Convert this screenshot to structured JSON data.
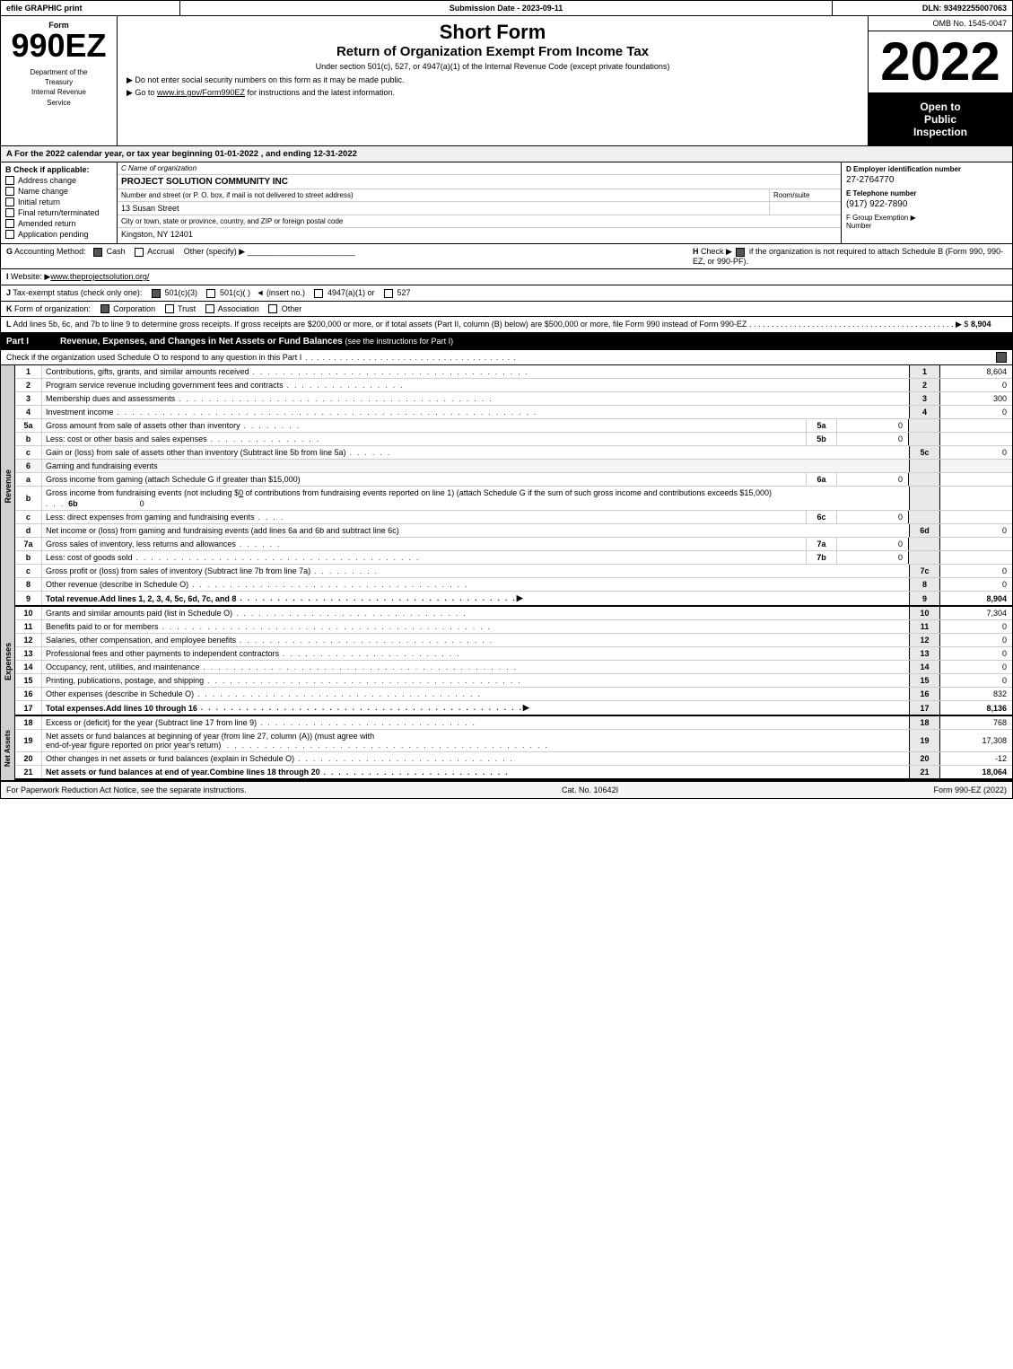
{
  "header": {
    "efile_label": "efile GRAPHIC print",
    "submission_label": "Submission Date - 2023-09-11",
    "dln_label": "DLN: 93492255007063"
  },
  "form_info": {
    "form_number": "990EZ",
    "dept_line1": "Department of the",
    "dept_line2": "Treasury",
    "dept_line3": "Internal Revenue",
    "dept_line4": "Service",
    "short_form": "Short Form",
    "return_title": "Return of Organization Exempt From Income Tax",
    "subtitle": "Under section 501(c), 527, or 4947(a)(1) of the Internal Revenue Code (except private foundations)",
    "bullet1": "▶ Do not enter social security numbers on this form as it may be made public.",
    "bullet2": "▶ Go to www.irs.gov/Form990EZ for instructions and the latest information.",
    "bullet2_link": "www.irs.gov/Form990EZ",
    "omb": "OMB No. 1545-0047",
    "year": "2022",
    "open_line1": "Open to",
    "open_line2": "Public",
    "open_line3": "Inspection"
  },
  "section_a": {
    "label": "A",
    "text": "For the 2022 calendar year, or tax year beginning 01-01-2022 , and ending 12-31-2022"
  },
  "section_b": {
    "label": "B",
    "check_label": "Check if applicable:",
    "options": [
      {
        "id": "address_change",
        "label": "Address change",
        "checked": false
      },
      {
        "id": "name_change",
        "label": "Name change",
        "checked": false
      },
      {
        "id": "initial_return",
        "label": "Initial return",
        "checked": false
      },
      {
        "id": "final_return",
        "label": "Final return/terminated",
        "checked": false
      },
      {
        "id": "amended_return",
        "label": "Amended return",
        "checked": false
      },
      {
        "id": "application_pending",
        "label": "Application pending",
        "checked": false
      }
    ]
  },
  "org": {
    "c_label": "C Name of organization",
    "name": "PROJECT SOLUTION COMMUNITY INC",
    "street_label": "Number and street (or P. O. box, if mail is not delivered to street address)",
    "street_value": "13 Susan Street",
    "room_label": "Room/suite",
    "room_value": "",
    "city_label": "City or town, state or province, country, and ZIP or foreign postal code",
    "city_value": "Kingston, NY 12401",
    "d_label": "D Employer identification number",
    "ein": "27-2764770",
    "e_label": "E Telephone number",
    "phone": "(917) 922-7890",
    "f_label": "F Group Exemption",
    "f_label2": "Number",
    "f_arrow": "▶"
  },
  "section_g": {
    "label": "G",
    "text": "Accounting Method:",
    "cash_label": "Cash",
    "cash_checked": true,
    "accrual_label": "Accrual",
    "accrual_checked": false,
    "other_label": "Other (specify) ▶",
    "other_line": "___________________________",
    "h_label": "H",
    "h_text": "Check ▶",
    "h_checked": true,
    "h_desc": "if the organization is not required to attach Schedule B (Form 990, 990-EZ, or 990-PF)."
  },
  "section_i": {
    "label": "I",
    "text": "Website: ▶www.theprojectsolution.org/"
  },
  "section_j": {
    "label": "J",
    "text": "Tax-exempt status (check only one):",
    "options": [
      {
        "label": "501(c)(3)",
        "checked": true
      },
      {
        "label": "501(c)(  )",
        "checked": false
      },
      {
        "label": "(insert no.) ◄"
      },
      {
        "label": "4947(a)(1) or",
        "checked": false
      },
      {
        "label": "527",
        "checked": false
      }
    ]
  },
  "section_k": {
    "label": "K",
    "text": "Form of organization:",
    "options": [
      {
        "label": "Corporation",
        "checked": true
      },
      {
        "label": "Trust",
        "checked": false
      },
      {
        "label": "Association",
        "checked": false
      },
      {
        "label": "Other",
        "checked": false
      }
    ]
  },
  "section_l": {
    "label": "L",
    "text": "Add lines 5b, 6c, and 7b to line 9 to determine gross receipts. If gross receipts are $200,000 or more, or if total assets (Part II, column (B) below) are $500,000 or more, file Form 990 instead of Form 990-EZ",
    "dots": ". . . . . . . . . . . . . . . . . . . . . . . . . . . . . . . . . . . . . . . . . . . . . .",
    "arrow": "▶ $",
    "value": "8,904"
  },
  "part1": {
    "label": "Part I",
    "title": "Revenue, Expenses, and Changes in Net Assets or Fund Balances",
    "subtitle": "(see the instructions for Part I)",
    "check_text": "Check if the organization used Schedule O to respond to any question in this Part I",
    "dots": ". . . . . . . . . . . . . . . . . . . . . . . . . . . . . . . . . . .",
    "check_box": true,
    "rows": [
      {
        "num": "1",
        "desc": "Contributions, gifts, grants, and similar amounts received",
        "dots": ". . . . . . . . . . . . . . . . . . . . . . . . . . . . . . . . . . . . . . .",
        "line": "1",
        "value": "8,604"
      },
      {
        "num": "2",
        "desc": "Program service revenue including government fees and contracts",
        "dots": ". . . . . . . . . . . . . . . . . . .",
        "line": "2",
        "value": "0"
      },
      {
        "num": "3",
        "desc": "Membership dues and assessments",
        "dots": ". . . . . . . . . . . . . . . . . . . . . . . . . . . . . . . . . . . . . . . . . . . . . .",
        "line": "3",
        "value": "300"
      },
      {
        "num": "4",
        "desc": "Investment income",
        "dots": ". . . . . . . . . . . . . . . . . . . . . . . . . . . . . . . . . . . . . . . . . . . . . . . . . . . . . . . . . . .",
        "line": "4",
        "value": "0"
      },
      {
        "num": "5a",
        "desc": "Gross amount from sale of assets other than inventory",
        "dots": ". . . . . . . .",
        "sub_line": "5a",
        "sub_val": "0"
      },
      {
        "num": "5b",
        "desc": "Less: cost or other basis and sales expenses",
        "dots": ". . . . . . . . . . . . . . .",
        "sub_line": "5b",
        "sub_val": "0"
      },
      {
        "num": "5c",
        "desc": "Gain or (loss) from sale of assets other than inventory (Subtract line 5b from line 5a)",
        "dots": ". . . . . .",
        "line": "5c",
        "value": "0"
      },
      {
        "num": "6",
        "desc": "Gaming and fundraising events",
        "is_header": true
      },
      {
        "num": "6a",
        "desc": "Gross income from gaming (attach Schedule G if greater than $15,000)",
        "dots": "",
        "sub_line": "6a",
        "sub_val": "0"
      },
      {
        "num": "6b",
        "desc": "Gross income from fundraising events (not including $ 0 of contributions from fundraising events reported on line 1) (attach Schedule G if the sum of such gross income and contributions exceeds $15,000)",
        "sub_line": "6b",
        "sub_val": "0",
        "multiline": true
      },
      {
        "num": "6c",
        "desc": "Less: direct expenses from gaming and fundraising events",
        "dots": ". . . .",
        "sub_line": "6c",
        "sub_val": "0"
      },
      {
        "num": "6d",
        "desc": "Net income or (loss) from gaming and fundraising events (add lines 6a and 6b and subtract line 6c)",
        "line": "6d",
        "value": "0"
      },
      {
        "num": "7a",
        "desc": "Gross sales of inventory, less returns and allowances",
        "dots": ". . . . . .",
        "sub_line": "7a",
        "sub_val": "0"
      },
      {
        "num": "7b",
        "desc": "Less: cost of goods sold",
        "dots": ". . . . . . . . . . . . . . . . . . . . . . . . . . . . . . . . . . . . . . . .",
        "sub_line": "7b",
        "sub_val": "0"
      },
      {
        "num": "7c",
        "desc": "Gross profit or (loss) from sales of inventory (Subtract line 7b from line 7a)",
        "dots": ". . . . . . . . . .",
        "line": "7c",
        "value": "0"
      },
      {
        "num": "8",
        "desc": "Other revenue (describe in Schedule O)",
        "dots": ". . . . . . . . . . . . . . . . . . . . . . . . . . . . . . . . . . . . .",
        "line": "8",
        "value": "0"
      },
      {
        "num": "9",
        "desc": "Total revenue. Add lines 1, 2, 3, 4, 5c, 6d, 7c, and 8",
        "dots": ". . . . . . . . . . . . . . . . . . . . . . . . . . . . . . . . . . . . .",
        "arrow": "▶",
        "line": "9",
        "value": "8,904",
        "bold": true
      }
    ],
    "expense_rows": [
      {
        "num": "10",
        "desc": "Grants and similar amounts paid (list in Schedule O)",
        "dots": ". . . . . . . . . . . . . . . . . . . . . . . . . . . . . . . .",
        "line": "10",
        "value": "7,304"
      },
      {
        "num": "11",
        "desc": "Benefits paid to or for members",
        "dots": ". . . . . . . . . . . . . . . . . . . . . . . . . . . . . . . . . . . . . . . . . . . . . .",
        "line": "11",
        "value": "0"
      },
      {
        "num": "12",
        "desc": "Salaries, other compensation, and employee benefits",
        "dots": ". . . . . . . . . . . . . . . . . . . . . . . . . . . . . . . . . .",
        "line": "12",
        "value": "0"
      },
      {
        "num": "13",
        "desc": "Professional fees and other payments to independent contractors",
        "dots": ". . . . . . . . . . . . . . . . . . . . . . . . .",
        "line": "13",
        "value": "0"
      },
      {
        "num": "14",
        "desc": "Occupancy, rent, utilities, and maintenance",
        "dots": ". . . . . . . . . . . . . . . . . . . . . . . . . . . . . . . . . . . . . . . . . .",
        "line": "14",
        "value": "0"
      },
      {
        "num": "15",
        "desc": "Printing, publications, postage, and shipping",
        "dots": ". . . . . . . . . . . . . . . . . . . . . . . . . . . . . . . . . . . . . . . . . .",
        "line": "15",
        "value": "0"
      },
      {
        "num": "16",
        "desc": "Other expenses (describe in Schedule O)",
        "dots": ". . . . . . . . . . . . . . . . . . . . . . . . . . . . . . . . . . . . . . .",
        "line": "16",
        "value": "832"
      },
      {
        "num": "17",
        "desc": "Total expenses. Add lines 10 through 16",
        "dots": ". . . . . . . . . . . . . . . . . . . . . . . . . . . . . . . . . . . . . . . . . . . .",
        "arrow": "▶",
        "line": "17",
        "value": "8,136",
        "bold": true
      }
    ],
    "net_rows": [
      {
        "num": "18",
        "desc": "Excess or (deficit) for the year (Subtract line 17 from line 9)",
        "dots": ". . . . . . . . . . . . . . . . . . . . . . . . . . . . . .",
        "line": "18",
        "value": "768"
      },
      {
        "num": "19",
        "desc": "Net assets or fund balances at beginning of year (from line 27, column (A)) (must agree with end-of-year figure reported on prior year's return)",
        "dots": ". . . . . . . . . . . . . . . . . . . . . . . . . . . . . . . . . . . . . . . . . . .",
        "line": "19",
        "value": "17,308",
        "multiline": true
      },
      {
        "num": "20",
        "desc": "Other changes in net assets or fund balances (explain in Schedule O)",
        "dots": ". . . . . . . . . . . . . . . . . . . . . . . . . . . . . .",
        "line": "20",
        "value": "-12"
      },
      {
        "num": "21",
        "desc": "Net assets or fund balances at end of year. Combine lines 18 through 20",
        "dots": ". . . . . . . . . . . . . . . . . . . . . . . . . .",
        "line": "21",
        "value": "18,064",
        "bold": true
      }
    ]
  },
  "footer": {
    "paperwork_text": "For Paperwork Reduction Act Notice, see the separate instructions.",
    "cat_no": "Cat. No. 10642I",
    "form_ref": "Form 990-EZ (2022)"
  }
}
